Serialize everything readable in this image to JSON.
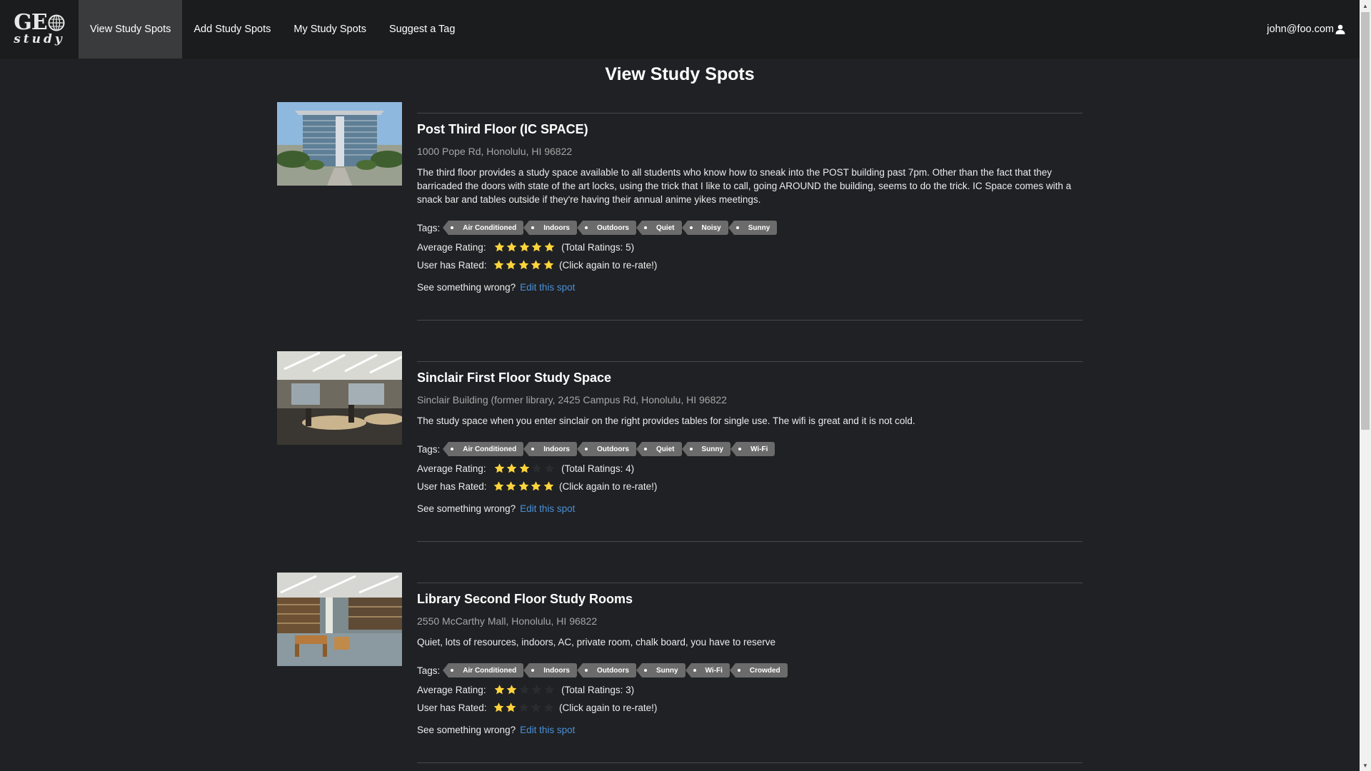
{
  "nav": {
    "logo_top": "GE",
    "logo_sub": "study",
    "items": [
      "View Study Spots",
      "Add Study Spots",
      "My Study Spots",
      "Suggest a Tag"
    ],
    "user": "john@foo.com"
  },
  "page": {
    "title": "View Study Spots"
  },
  "labels": {
    "tags": "Tags:",
    "average": "Average Rating:",
    "user_rated": "User has Rated:",
    "rerate": "(Click again to re-rate!)",
    "wrong": "See something wrong?",
    "edit": "Edit this spot"
  },
  "spots": [
    {
      "name": "Post Third Floor (IC SPACE)",
      "address": "1000 Pope Rd, Honolulu, HI 96822",
      "description": "The third floor provides a study space available to all students who know how to sneak into the POST building past 7pm. Other than the fact that they barricaded the doors with state of the art locks, using the trick that I like to call, going AROUND the building, seems to do the trick. IC Space comes with a snack bar and tables outside if they're having their annual anime yikes meetings.",
      "tags": [
        "Air Conditioned",
        "Indoors",
        "Outdoors",
        "Quiet",
        "Noisy",
        "Sunny"
      ],
      "average_rating": 5,
      "total_ratings": "(Total Ratings: 5)",
      "user_rating": 5
    },
    {
      "name": "Sinclair First Floor Study Space",
      "address": "Sinclair Building (former library, 2425 Campus Rd, Honolulu, HI 96822",
      "description": "The study space when you enter sinclair on the right provides tables for single use. The wifi is great and it is not cold.",
      "tags": [
        "Air Conditioned",
        "Indoors",
        "Outdoors",
        "Quiet",
        "Sunny",
        "Wi-Fi"
      ],
      "average_rating": 3,
      "total_ratings": "(Total Ratings: 4)",
      "user_rating": 5
    },
    {
      "name": "Library Second Floor Study Rooms",
      "address": "2550 McCarthy Mall, Honolulu, HI 96822",
      "description": "Quiet, lots of resources, indoors, AC, private room, chalk board, you have to reserve",
      "tags": [
        "Air Conditioned",
        "Indoors",
        "Outdoors",
        "Sunny",
        "Wi-Fi",
        "Crowded"
      ],
      "average_rating": 2,
      "total_ratings": "(Total Ratings: 3)",
      "user_rating": 2
    }
  ],
  "colors": {
    "star_on": "#ffd43b",
    "star_off": "#2a2b2e",
    "link": "#4a90d9",
    "tag_bg": "#6b6b6b"
  }
}
